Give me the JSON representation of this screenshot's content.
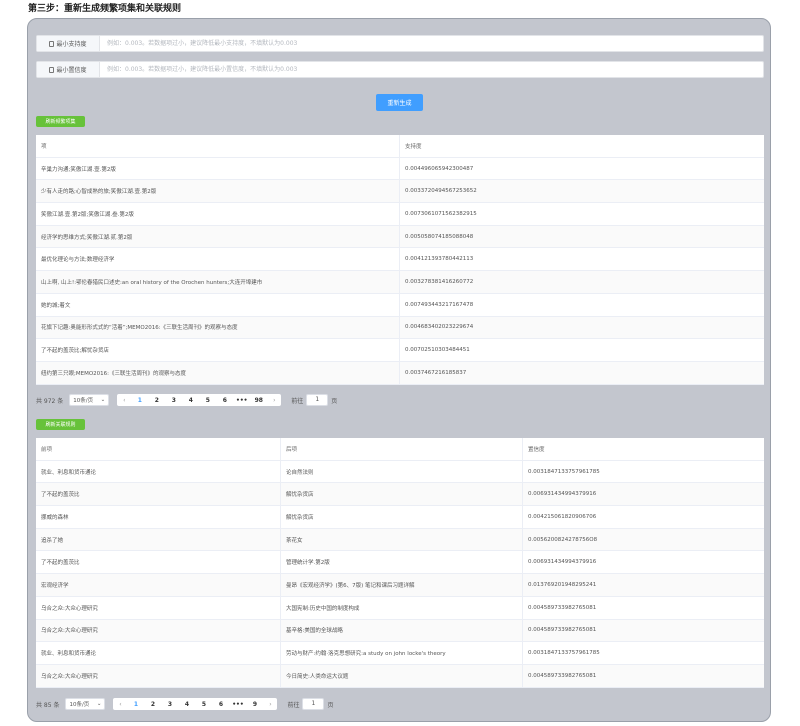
{
  "page_title": "第三步：重新生成频繁项集和关联规则",
  "params": {
    "support": {
      "label": "最小支持度",
      "placeholder": "例如：0.003。若数据项过小，建议降低最小支持度，不填默认为0.003"
    },
    "confidence": {
      "label": "最小置信度",
      "placeholder": "例如：0.003。若数据项过小，建议降低最小置信度，不填默认为0.003"
    }
  },
  "regen_button": "重新生成",
  "itemsets": {
    "button": "刷新频繁项集",
    "headers": [
      "项",
      "支持度"
    ],
    "rows": [
      [
        "辛巢力沟通;笑傲江湖.壹.第2版",
        "0.004496065942300487"
      ],
      [
        "少有人走的路;心智成熟的旅;笑傲江湖.壹.第2版",
        "0.0033720494567253652"
      ],
      [
        "笑傲江湖.壹.第2版;笑傲江湖.叁.第2版",
        "0.0073061071562382915"
      ],
      [
        "经济学的思维方式;笑傲江湖.贰.第2版",
        "0.005058074185088048"
      ],
      [
        "最优化理论与方法;数理经济学",
        "0.004121393780442113"
      ],
      [
        "山上啊, 山上!:鄂伦春猎民口述史:an oral history of the Orochen hunters;大连开埠建市",
        "0.003278381416260772"
      ],
      [
        "她的城;着文",
        "0.007493443217167478"
      ],
      [
        "花旗下记趣:奥能形形式式的“活着”;MEMO2016:《三联生活周刊》的观察与态度",
        "0.004683402023229674"
      ],
      [
        "了不起的盖茨比;解忧杂货店",
        "0.00702510303484451"
      ],
      [
        "纽约第三只眼;MEMO2016:《三联生活周刊》的观察与态度",
        "0.0037467216185837"
      ]
    ],
    "pager": {
      "total": "共 972 条",
      "size": "10条/页",
      "pages": [
        "1",
        "2",
        "3",
        "4",
        "5",
        "6",
        "•••",
        "98"
      ],
      "goto_prefix": "前往",
      "goto_value": "1",
      "goto_suffix": "页"
    }
  },
  "rules": {
    "button": "刷新关联规则",
    "headers": [
      "前项",
      "后项",
      "置信度"
    ],
    "rows": [
      [
        "就业、利息和货币通论",
        "论自然法则",
        "0.0031847133757961785"
      ],
      [
        "了不起的盖茨比",
        "解忧杂货店",
        "0.006931434994379916"
      ],
      [
        "挪威的森林",
        "解忧杂货店",
        "0.004215061820906706"
      ],
      [
        "追杀了她",
        "茶花女",
        "0.0056200824278756O8"
      ],
      [
        "了不起的盖茨比",
        "管理统计学.第2版",
        "0.006931434994379916"
      ],
      [
        "宏观经济学",
        "曼昂《宏观经济学》(第6、7版) 笔记和课后习题详解",
        "0.013769201948295241"
      ],
      [
        "乌合之众:大众心理研究",
        "大国宪制:历史中国的制度构成",
        "0.004589733982765081"
      ],
      [
        "乌合之众:大众心理研究",
        "基辛格:美国的全球战略",
        "0.004589733982765081"
      ],
      [
        "就业、利息和货币通论",
        "劳动与财产:约翰·洛克思想研究:a study on john locke's theory",
        "0.0031847133757961785"
      ],
      [
        "乌合之众:大众心理研究",
        "今日简史:人类命运大议题",
        "0.004589733982765081"
      ]
    ],
    "pager": {
      "total": "共 85 条",
      "size": "10条/页",
      "pages": [
        "1",
        "2",
        "3",
        "4",
        "5",
        "6",
        "•••",
        "9"
      ],
      "goto_prefix": "前往",
      "goto_value": "1",
      "goto_suffix": "页"
    }
  }
}
